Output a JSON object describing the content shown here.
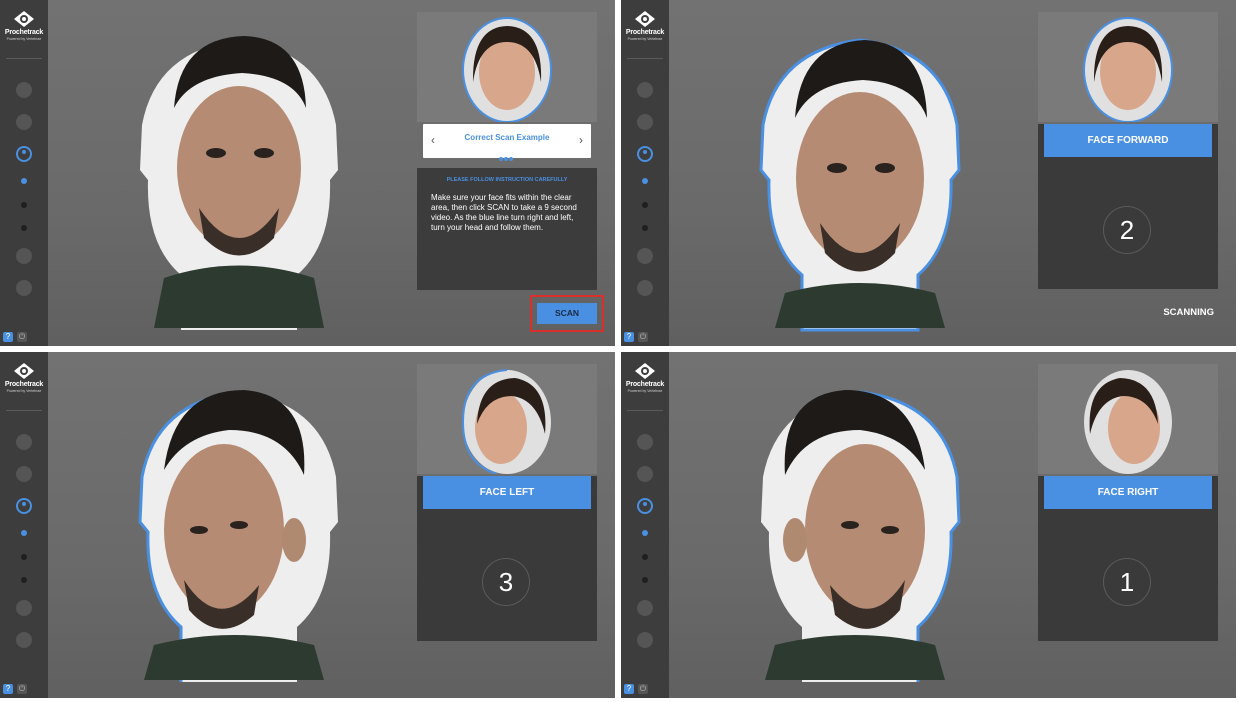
{
  "app": {
    "logo_text": "Prochetrack",
    "logo_subtext": "Powered by Vertebrae"
  },
  "icons": {
    "logo": "eye-icon",
    "nav": [
      "pencil-icon",
      "settings-icon",
      "face-scan-icon",
      "dot-icon",
      "dot-icon",
      "dot-icon",
      "camera-icon",
      "download-icon"
    ],
    "help": "help-icon",
    "power": "power-icon"
  },
  "colors": {
    "accent": "#4a90e2",
    "sidebar": "#3d3d3d",
    "panel_dark": "#3a3a3a",
    "highlight_red": "#d9302c"
  },
  "panels": [
    {
      "step": "intro",
      "example_title": "Correct Scan Example",
      "instruction_heading": "PLEASE FOLLOW INSTRUCTION CAREFULLY",
      "instruction_body": "Make sure your face fits within the clear area, then click SCAN to take a 9 second video. As the blue line turn right and left, turn your head and follow them.",
      "scan_label": "SCAN"
    },
    {
      "step": "face-forward",
      "banner": "FACE FORWARD",
      "countdown": "2",
      "status": "SCANNING"
    },
    {
      "step": "face-left",
      "banner": "FACE LEFT",
      "countdown": "3"
    },
    {
      "step": "face-right",
      "banner": "FACE RIGHT",
      "countdown": "1"
    }
  ]
}
